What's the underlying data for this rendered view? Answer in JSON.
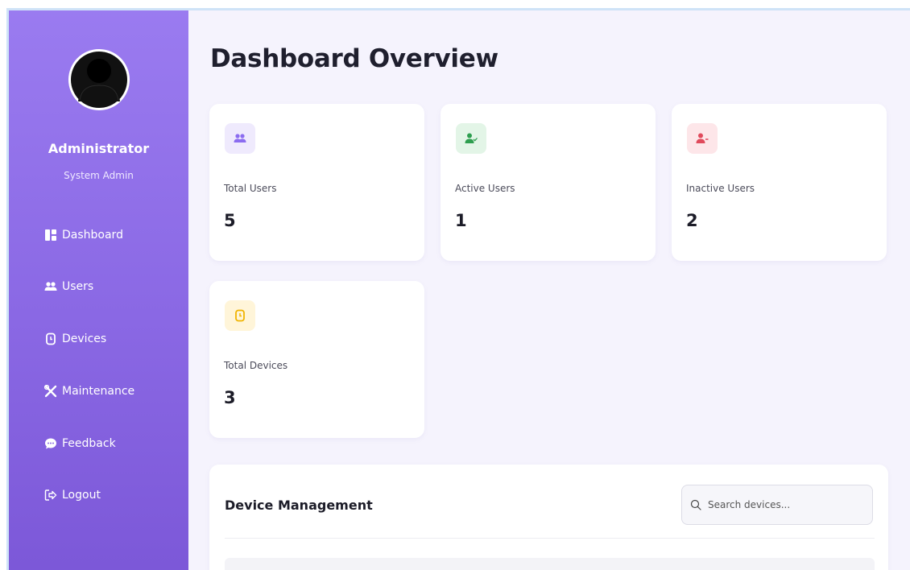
{
  "sidebar": {
    "user_name": "Administrator",
    "user_role": "System Admin",
    "items": [
      {
        "label": "Dashboard",
        "icon": "dashboard-icon"
      },
      {
        "label": "Users",
        "icon": "users-icon"
      },
      {
        "label": "Devices",
        "icon": "watch-icon"
      },
      {
        "label": "Maintenance",
        "icon": "tools-icon"
      },
      {
        "label": "Feedback",
        "icon": "chat-icon"
      },
      {
        "label": "Logout",
        "icon": "logout-icon"
      }
    ]
  },
  "main": {
    "title": "Dashboard Overview",
    "stats": [
      {
        "label": "Total Users",
        "value": "5",
        "icon": "users-icon",
        "color": "#8b6cf0"
      },
      {
        "label": "Active Users",
        "value": "1",
        "icon": "user-check-icon",
        "color": "#2e9e4f"
      },
      {
        "label": "Inactive Users",
        "value": "2",
        "icon": "user-minus-icon",
        "color": "#e04a5c"
      },
      {
        "label": "Total Devices",
        "value": "3",
        "icon": "watch-icon",
        "color": "#f0b400"
      }
    ],
    "device_panel": {
      "title": "Device Management",
      "search_placeholder": "Search devices..."
    }
  },
  "colors": {
    "sidebar_top": "#9a7bf0",
    "sidebar_bottom": "#7c58d8",
    "page_bg": "#f5f3fd",
    "card_bg": "#ffffff"
  }
}
